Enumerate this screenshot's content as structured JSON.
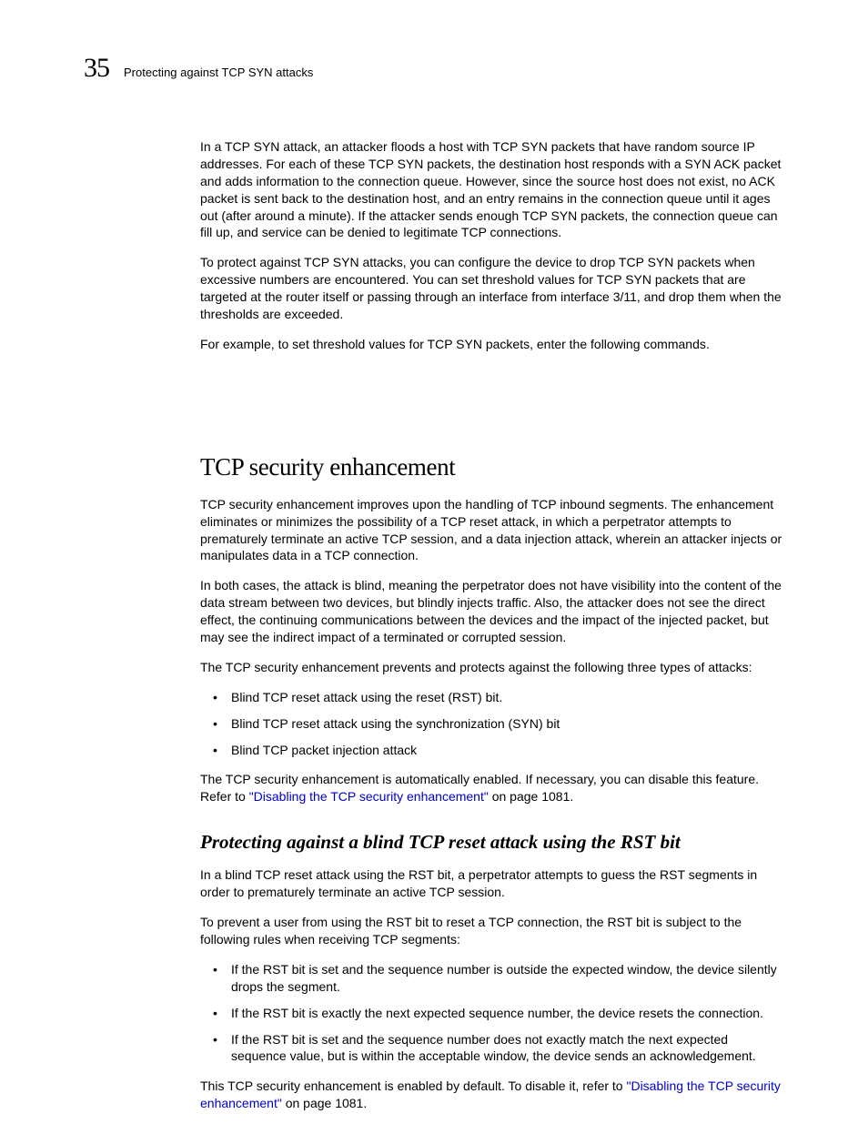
{
  "header": {
    "chapter_number": "35",
    "running_title": "Protecting against TCP SYN attacks"
  },
  "intro": {
    "p1": "In a TCP SYN attack, an attacker floods a host with TCP SYN packets that have random source IP addresses.  For each of these TCP SYN packets, the destination host responds with a SYN ACK packet and adds information to the connection queue.  However, since the source host does not exist, no ACK packet is sent back to the destination host, and an entry remains in the connection queue until it ages out (after around a minute).  If the attacker sends enough TCP SYN packets, the connection queue can fill up, and service can be denied to legitimate TCP connections.",
    "p2": "To protect against TCP SYN attacks, you can configure the device to drop TCP SYN packets when excessive numbers are encountered. You can set threshold values for TCP SYN packets that are targeted at the router itself or passing through an interface from interface 3/11, and drop them when the thresholds are exceeded.",
    "p3": "For example, to set threshold values for TCP SYN packets, enter the following commands."
  },
  "section": {
    "title": "TCP security enhancement",
    "p1": "TCP security enhancement improves upon the handling of TCP inbound segments.  The enhancement eliminates or minimizes the possibility of a TCP reset attack, in which a perpetrator attempts to prematurely terminate an active TCP session, and a data injection attack, wherein an attacker injects or manipulates data in a TCP connection.",
    "p2": "In both cases, the attack is blind, meaning the perpetrator does not have visibility into the content of the data stream between two devices, but blindly injects traffic. Also, the attacker does not see the direct effect, the continuing communications between the devices and the impact of the injected packet, but may see the indirect impact of a terminated or corrupted session.",
    "p3": "The TCP security enhancement prevents and protects against the following three types of attacks:",
    "bullets1": [
      "Blind TCP reset attack using the reset (RST) bit.",
      "Blind TCP reset attack using the synchronization (SYN) bit",
      "Blind TCP packet injection attack"
    ],
    "p4_a": "The TCP security enhancement is automatically enabled. If necessary, you can disable this feature. Refer to ",
    "p4_link": "\"Disabling the TCP security enhancement\"",
    "p4_b": " on page 1081."
  },
  "subsection": {
    "title": "Protecting against a blind TCP reset attack using the RST bit",
    "p1": "In a blind TCP reset attack using the RST bit, a perpetrator attempts to guess the RST segments in order to prematurely terminate an active TCP session.",
    "p2": "To prevent a user from using the RST bit to reset a TCP connection, the RST bit is subject to the following rules when receiving TCP segments:",
    "bullets": [
      "If the RST bit is set and the sequence number is outside the expected window, the device silently drops the segment.",
      "If the RST bit is exactly the next expected sequence number, the device resets the connection.",
      "If the RST bit is set and the sequence number does not exactly match the next expected sequence value, but is within the acceptable window, the device sends an acknowledgement."
    ],
    "p3_a": "This TCP security enhancement is enabled by default. To disable it, refer to ",
    "p3_link": "\"Disabling the TCP security enhancement\"",
    "p3_b": " on page 1081."
  }
}
